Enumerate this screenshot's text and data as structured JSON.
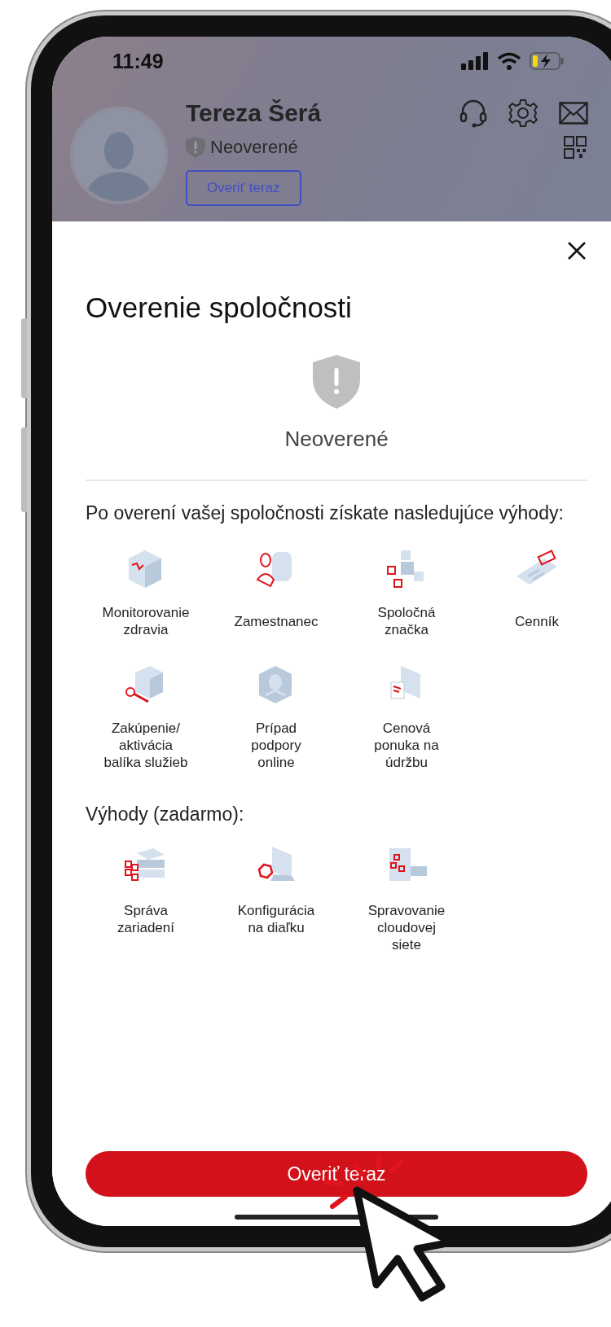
{
  "status_bar": {
    "time": "11:49"
  },
  "profile": {
    "name": "Tereza Šerá",
    "status": "Neoverené",
    "verify_button": "Overiť teraz"
  },
  "sheet": {
    "title": "Overenie spoločnosti",
    "status": "Neoverené",
    "intro": "Po overení vašej spoločnosti získate nasledujúce výhody:",
    "benefits": [
      {
        "label": "Monitorovanie\nzdravia"
      },
      {
        "label": "Zamestnanec"
      },
      {
        "label": "Spoločná\nznačka"
      },
      {
        "label": "Cenník"
      },
      {
        "label": "Zakúpenie/\naktivácia\nbalíka služieb"
      },
      {
        "label": "Prípad\npodpory\nonline"
      },
      {
        "label": "Cenová\nponuka na\núdržbu"
      }
    ],
    "free_title": "Výhody (zadarmo):",
    "free_benefits": [
      {
        "label": "Správa\nzariadení"
      },
      {
        "label": "Konfigurácia\nna diaľku"
      },
      {
        "label": "Spravovanie\ncloudovej\nsiete"
      }
    ],
    "button": "Overiť teraz"
  }
}
